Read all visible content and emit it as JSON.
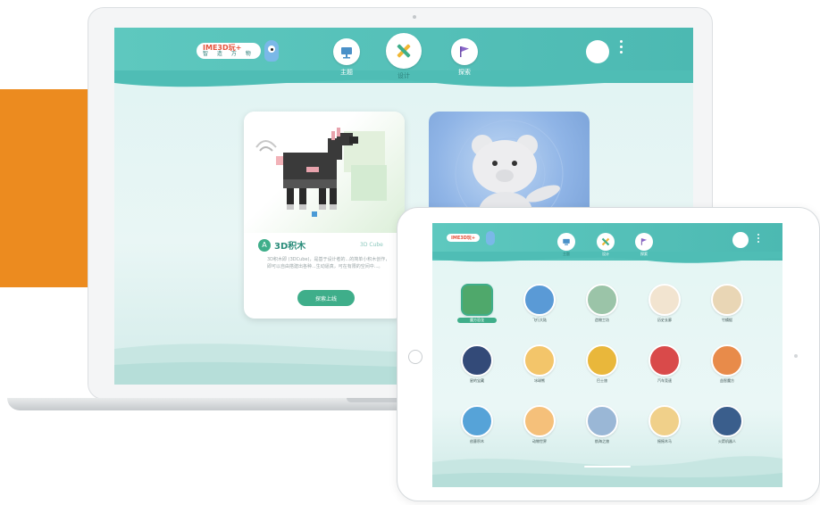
{
  "laptop": {
    "logo": {
      "title": "IME3D玩+",
      "subtitle": "智 造 万 物"
    },
    "nav": [
      {
        "label": "主题",
        "icon": "monitor-icon"
      },
      {
        "label": "设计",
        "icon": "cross-tools-icon",
        "active": true
      },
      {
        "label": "探索",
        "icon": "flag-icon"
      }
    ],
    "card": {
      "title": "3D积木",
      "title_en": "3D Cube",
      "badge": "A",
      "description": "3D积木即 (3DCube)，是基于设计者的...的简单小积木创作，即可以自由搭建出各种...生动逼真，可在有限的空间中...。",
      "button": "探索上线"
    }
  },
  "tablet": {
    "logo": "IME3D玩+",
    "nav": [
      {
        "label": "主题",
        "active": true
      },
      {
        "label": "设计"
      },
      {
        "label": "探索"
      }
    ],
    "grid": [
      {
        "label": "魔方恐龙",
        "color": "#4fa86b",
        "selected": true
      },
      {
        "label": "飞行大陆",
        "color": "#5a9ad6"
      },
      {
        "label": "造物工坊",
        "color": "#9bc4a8"
      },
      {
        "label": "历史长廊",
        "color": "#f2e4d0"
      },
      {
        "label": "竹蜻蜓",
        "color": "#e9d6b5"
      },
      {
        "label": "星的宝藏",
        "color": "#334a78"
      },
      {
        "label": "冰球熊",
        "color": "#f3c56a"
      },
      {
        "label": "巴士旅",
        "color": "#e9b73b"
      },
      {
        "label": "汽车竞速",
        "color": "#d94a4a"
      },
      {
        "label": "益智魔方",
        "color": "#e88b4a"
      },
      {
        "label": "创意积木",
        "color": "#56a3d8"
      },
      {
        "label": "动物世界",
        "color": "#f5c07a"
      },
      {
        "label": "航海之旅",
        "color": "#9ab7d6"
      },
      {
        "label": "摇摇木马",
        "color": "#f0d08a"
      },
      {
        "label": "火箭机器人",
        "color": "#3a5e8c"
      }
    ]
  }
}
